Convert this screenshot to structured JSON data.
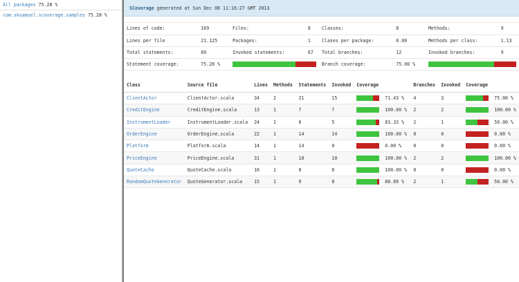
{
  "sidebar": {
    "all_packages": {
      "label": "All packages",
      "pct": "75.28 %"
    },
    "packages": [
      {
        "label": "com.sksamuel.scoverage.samples",
        "pct": "75.28 %"
      }
    ]
  },
  "header": {
    "brand": "SCoverage",
    "generated": "generated at Sun Dec 08 11:16:27 GMT 2013"
  },
  "stats": {
    "lines_of_code_label": "Lines of code:",
    "lines_of_code": "169",
    "files_label": "Files:",
    "files": "8",
    "classes_label": "Classes:",
    "classes": "8",
    "methods_label": "Methods:",
    "methods": "9",
    "lines_per_file_label": "Lines per file",
    "lines_per_file": "21.125",
    "packages_label": "Packages:",
    "packages": "1",
    "classes_per_package_label": "Clases per package:",
    "classes_per_package": "8.00",
    "methods_per_class_label": "Methods per class:",
    "methods_per_class": "1.13",
    "total_statements_label": "Total statements:",
    "total_statements": "89",
    "invoked_statements_label": "Invoked statements:",
    "invoked_statements": "67",
    "total_branches_label": "Total branches:",
    "total_branches": "12",
    "invoked_branches_label": "Invoked branches:",
    "invoked_branches": "9",
    "statement_coverage_label": "Statement coverage:",
    "statement_coverage": "75.28 %",
    "statement_coverage_fraction": 0.7528,
    "branch_coverage_label": "Branch coverage:",
    "branch_coverage": "75.00 %",
    "branch_coverage_fraction": 0.75
  },
  "table": {
    "headers": [
      "Class",
      "Source file",
      "Lines",
      "Methods",
      "Statements",
      "Invoked",
      "Coverage",
      "",
      "Branches",
      "Invoked",
      "Coverage",
      ""
    ],
    "rows": [
      {
        "class": "ClientActor",
        "file": "ClientActor.scala",
        "lines": "34",
        "methods": "2",
        "statements": "21",
        "invoked": "15",
        "cov": "71.43 %",
        "cov_frac": 0.7143,
        "branches": "4",
        "binvoked": "3",
        "bcov": "75.00 %",
        "bcov_frac": 0.75
      },
      {
        "class": "CreditEngine",
        "file": "CreditEngine.scala",
        "lines": "13",
        "methods": "1",
        "statements": "7",
        "invoked": "7",
        "cov": "100.00 %",
        "cov_frac": 1.0,
        "branches": "2",
        "binvoked": "2",
        "bcov": "100.00 %",
        "bcov_frac": 1.0
      },
      {
        "class": "InstrumentLoader",
        "file": "InstrumentLoader.scala",
        "lines": "24",
        "methods": "1",
        "statements": "6",
        "invoked": "5",
        "cov": "83.33 %",
        "cov_frac": 0.8333,
        "branches": "2",
        "binvoked": "1",
        "bcov": "50.00 %",
        "bcov_frac": 0.5
      },
      {
        "class": "OrderEngine",
        "file": "OrderEngine.scala",
        "lines": "22",
        "methods": "1",
        "statements": "14",
        "invoked": "14",
        "cov": "100.00 %",
        "cov_frac": 1.0,
        "branches": "0",
        "binvoked": "0",
        "bcov": "0.00 %",
        "bcov_frac": 0.0
      },
      {
        "class": "Platform",
        "file": "Platform.scala",
        "lines": "14",
        "methods": "1",
        "statements": "14",
        "invoked": "0",
        "cov": "0.00 %",
        "cov_frac": 0.0,
        "branches": "0",
        "binvoked": "0",
        "bcov": "0.00 %",
        "bcov_frac": 0.0
      },
      {
        "class": "PriceEngine",
        "file": "PriceEngine.scala",
        "lines": "31",
        "methods": "1",
        "statements": "10",
        "invoked": "10",
        "cov": "100.00 %",
        "cov_frac": 1.0,
        "branches": "2",
        "binvoked": "2",
        "bcov": "100.00 %",
        "bcov_frac": 1.0
      },
      {
        "class": "QuoteCache",
        "file": "QuoteCache.scala",
        "lines": "16",
        "methods": "1",
        "statements": "8",
        "invoked": "8",
        "cov": "100.00 %",
        "cov_frac": 1.0,
        "branches": "0",
        "binvoked": "0",
        "bcov": "0.00 %",
        "bcov_frac": 0.0
      },
      {
        "class": "RandomQuoteGenerator",
        "file": "QuoteGenerator.scala",
        "lines": "15",
        "methods": "1",
        "statements": "9",
        "invoked": "8",
        "cov": "88.89 %",
        "cov_frac": 0.8889,
        "branches": "2",
        "binvoked": "1",
        "bcov": "50.00 %",
        "bcov_frac": 0.5
      }
    ]
  },
  "colors": {
    "covered": "#3ec43e",
    "uncovered": "#c42121",
    "link": "#3a7ab8",
    "banner": "#d9e9f5"
  }
}
